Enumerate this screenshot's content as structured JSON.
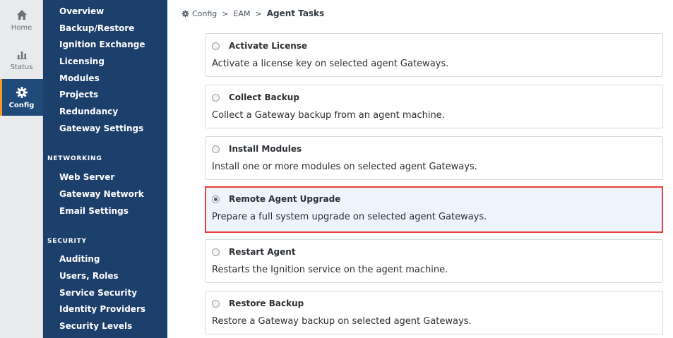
{
  "rail": {
    "items": [
      {
        "label": "Home",
        "icon": "home-icon"
      },
      {
        "label": "Status",
        "icon": "bar-chart-icon"
      },
      {
        "label": "Config",
        "icon": "gear-icon",
        "active": true
      }
    ]
  },
  "sidebar": {
    "links_top": [
      "Overview",
      "Backup/Restore",
      "Ignition Exchange",
      "Licensing",
      "Modules",
      "Projects",
      "Redundancy",
      "Gateway Settings"
    ],
    "networking_heading": "NETWORKING",
    "links_networking": [
      "Web Server",
      "Gateway Network",
      "Email Settings"
    ],
    "security_heading": "SECURITY",
    "links_security": [
      "Auditing",
      "Users, Roles",
      "Service Security",
      "Identity Providers",
      "Security Levels"
    ]
  },
  "breadcrumb": {
    "root": "Config",
    "separator": ">",
    "middle": "EAM",
    "current": "Agent Tasks"
  },
  "tasks": [
    {
      "title": "Activate License",
      "description": "Activate a license key on selected agent Gateways.",
      "selected": false
    },
    {
      "title": "Collect Backup",
      "description": "Collect a Gateway backup from an agent machine.",
      "selected": false
    },
    {
      "title": "Install Modules",
      "description": "Install one or more modules on selected agent Gateways.",
      "selected": false
    },
    {
      "title": "Remote Agent Upgrade",
      "description": "Prepare a full system upgrade on selected agent Gateways.",
      "selected": true
    },
    {
      "title": "Restart Agent",
      "description": "Restarts the Ignition service on the agent machine.",
      "selected": false
    },
    {
      "title": "Restore Backup",
      "description": "Restore a Gateway backup on selected agent Gateways.",
      "selected": false
    }
  ],
  "colors": {
    "sidebar_bg": "#1d3f6b",
    "active_rail_bg": "#1f4a7a",
    "active_accent": "#f59a23",
    "highlight_border": "#e8413d",
    "selected_card_bg": "#eef4fb"
  }
}
